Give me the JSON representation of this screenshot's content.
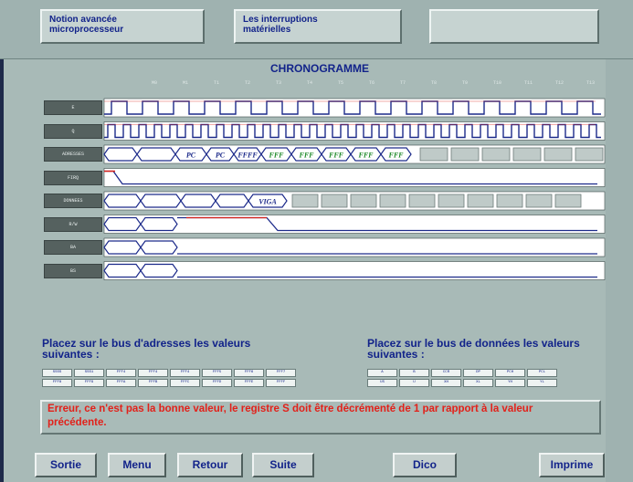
{
  "header": {
    "box1_line1": "Notion avancée",
    "box1_line2": "microprocesseur",
    "box2_line1": "Les interruptions",
    "box2_line2": "matérielles"
  },
  "chrono": {
    "title": "CHRONOGRAMME",
    "ticks": [
      "M0",
      "M1",
      "T1",
      "T2",
      "T3",
      "T4",
      "T5",
      "T6",
      "T7",
      "T8",
      "T9",
      "T10",
      "T11",
      "T12",
      "T13"
    ],
    "rows": [
      {
        "label": "E"
      },
      {
        "label": "Q"
      },
      {
        "label": "ADRESSES"
      },
      {
        "label": "FIRQ"
      },
      {
        "label": "DONNEES"
      },
      {
        "label": "R/W"
      },
      {
        "label": "BA"
      },
      {
        "label": "BS"
      }
    ],
    "addr_values": [
      "PC",
      "PC",
      "FFFF",
      "FFF",
      "FFF",
      "FFF",
      "FFF",
      "FFF"
    ],
    "data_value": "VIGA"
  },
  "bottom": {
    "left_instruction": "Placez sur le bus d'adresses les valeurs suivantes :",
    "right_instruction": "Placez sur le bus de données les valeurs suivantes :",
    "left_row1": [
      "SSSS",
      "SSS1",
      "FFF4",
      "FFF4",
      "FFF4",
      "FFF5",
      "FFF6",
      "FFF7"
    ],
    "left_row2": [
      "FFF8",
      "FFF9",
      "FFFA",
      "FFFB",
      "FFFC",
      "FFFD",
      "FFFE",
      "FFFF"
    ],
    "right_row1": [
      "A",
      "B",
      "CCR",
      "DP",
      "PCH",
      "PCL"
    ],
    "right_row2": [
      "US",
      "U",
      "XH",
      "XL",
      "YH",
      "YL"
    ],
    "error": "Erreur, ce n'est pas la bonne valeur, le registre S doit être décrémenté de 1 par rapport à la valeur précédente."
  },
  "nav": {
    "sortie": "Sortie",
    "menu": "Menu",
    "retour": "Retour",
    "suite": "Suite",
    "dico": "Dico",
    "imprime": "Imprime"
  },
  "colors": {
    "text_blue": "#12238a",
    "error_red": "#e2211a",
    "wave_blue": "#1c2a8a",
    "wave_red": "#d8231b",
    "addr_green": "#1f8a2a"
  }
}
